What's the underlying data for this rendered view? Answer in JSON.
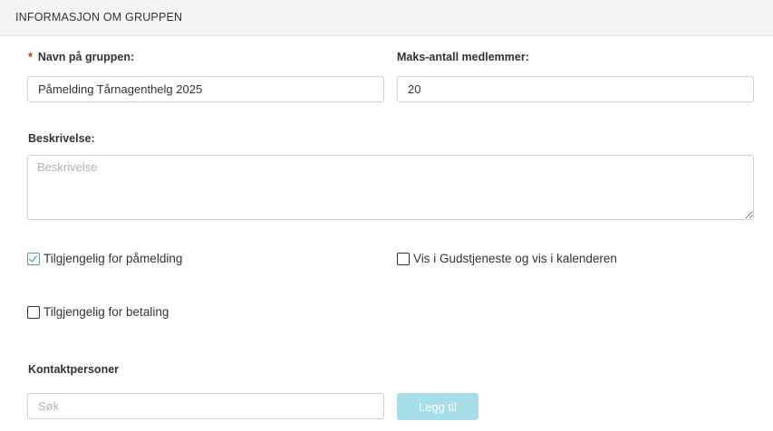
{
  "section": {
    "title": "INFORMASJON OM GRUPPEN"
  },
  "fields": {
    "name": {
      "required_mark": "*",
      "label": "Navn på gruppen:",
      "value": "Påmelding Tårnagenthelg 2025"
    },
    "max_members": {
      "label": "Maks-antall medlemmer:",
      "value": "20"
    },
    "description": {
      "label": "Beskrivelse:",
      "placeholder": "Beskrivelse",
      "value": ""
    }
  },
  "options": {
    "available_signup": {
      "label": "Tilgjengelig for påmelding",
      "checked": true
    },
    "show_in_service": {
      "label": "Vis i Gudstjeneste og vis i kalenderen",
      "checked": false
    },
    "available_payment": {
      "label": "Tilgjengelig for betaling",
      "checked": false
    }
  },
  "contacts": {
    "label": "Kontaktpersoner",
    "search_placeholder": "Søk",
    "add_button": "Legg til"
  },
  "colors": {
    "header_bg": "#f4f4f4",
    "required": "#e02424",
    "add_button_bg": "#a6dde9",
    "check_accent": "#2a8fd0"
  },
  "icons": {
    "checkmark": "check-icon"
  }
}
